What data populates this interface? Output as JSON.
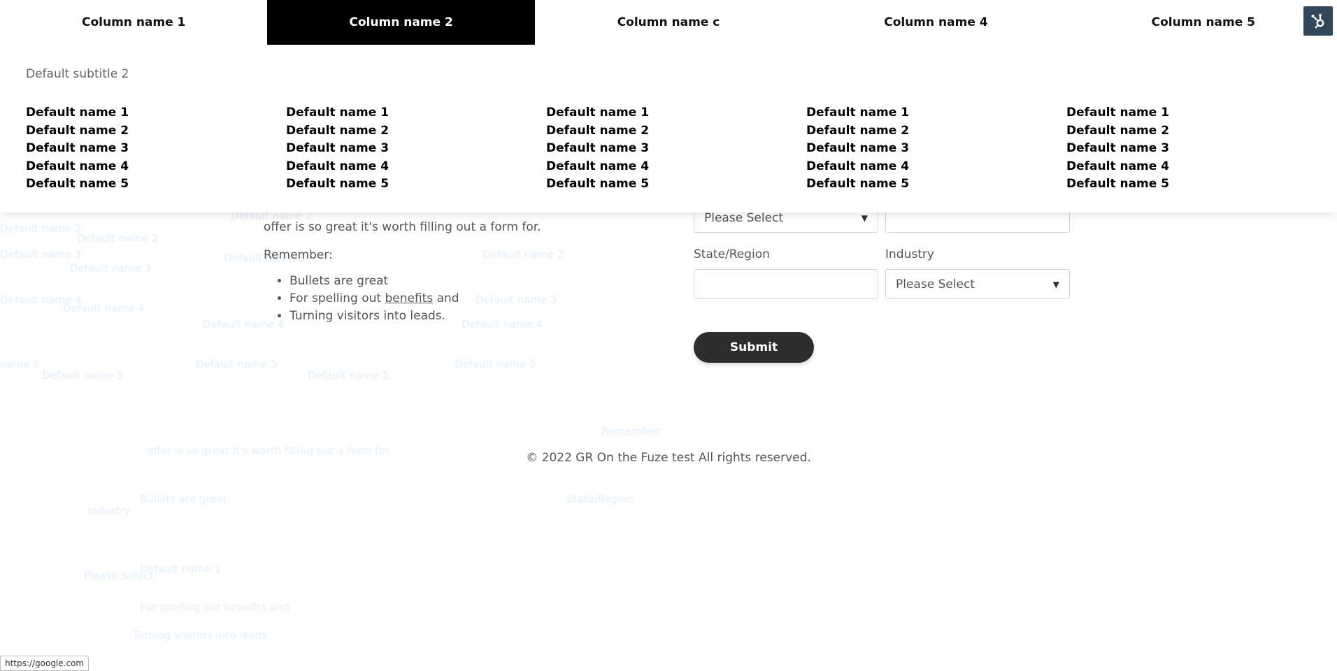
{
  "colors": {
    "active_tab_bg": "#000000",
    "active_tab_text": "#ffffff",
    "submit_bg": "#2d2d2d",
    "sprocket_bg": "#33475b"
  },
  "menu": {
    "tabs": [
      {
        "label": "Column name 1",
        "active": false
      },
      {
        "label": "Column name 2",
        "active": true
      },
      {
        "label": "Column name c",
        "active": false
      },
      {
        "label": "Column name 4",
        "active": false
      },
      {
        "label": "Column name 5",
        "active": false
      }
    ],
    "subtitle": "Default subtitle 2",
    "columns": [
      {
        "links": [
          "Default name 1",
          "Default name 2",
          "Default name 3",
          "Default name 4",
          "Default name 5"
        ]
      },
      {
        "links": [
          "Default name 1",
          "Default name 2",
          "Default name 3",
          "Default name 4",
          "Default name 5"
        ]
      },
      {
        "links": [
          "Default name 1",
          "Default name 2",
          "Default name 3",
          "Default name 4",
          "Default name 5"
        ]
      },
      {
        "links": [
          "Default name 1",
          "Default name 2",
          "Default name 3",
          "Default name 4",
          "Default name 5"
        ]
      },
      {
        "links": [
          "Default name 1",
          "Default name 2",
          "Default name 3",
          "Default name 4",
          "Default name 5"
        ]
      }
    ]
  },
  "sprocket_icon": "hubspot-sprocket-icon",
  "copy": {
    "offer_line": "offer is so great it's worth filling out a form for.",
    "remember": "Remember:",
    "bullets": {
      "b1": "Bullets are great",
      "b2_before": "For spelling out",
      "b2_link": "benefits",
      "b2_after": "and",
      "b3": "Turning visitors into leads."
    }
  },
  "form": {
    "top_select_value": "Please Select",
    "top_input_value": "",
    "state_label": "State/Region",
    "state_value": "",
    "industry_label": "Industry",
    "industry_value": "Please Select",
    "submit_label": "Submit"
  },
  "footer": {
    "text": "© 2022 GR On the Fuze test All rights reserved."
  },
  "status_bar": {
    "url": "https://google.com"
  }
}
